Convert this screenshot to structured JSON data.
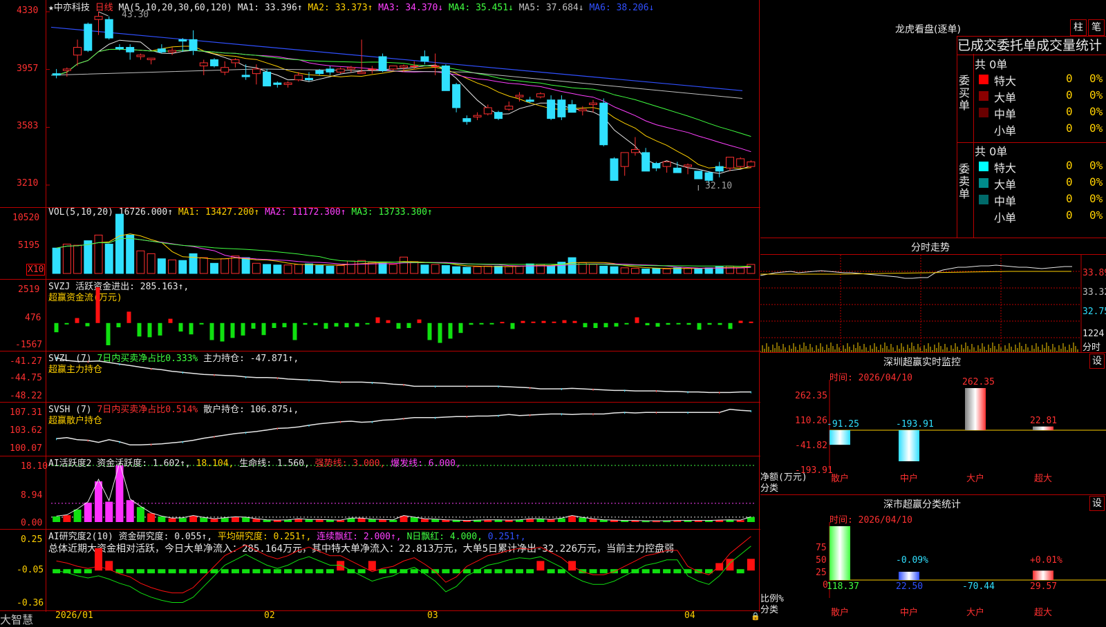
{
  "brand": "大智慧",
  "stock": {
    "name": "中亦科技",
    "period": "日线"
  },
  "main": {
    "ma_label": "MA(5,10,20,30,60,120)",
    "ma_items": [
      {
        "name": "MA1:",
        "value": "33.396↑",
        "color": "#e8e8e8"
      },
      {
        "name": "MA2:",
        "value": "33.373↑",
        "color": "#ffd000"
      },
      {
        "name": "MA3:",
        "value": "34.370↓",
        "color": "#ff40ff"
      },
      {
        "name": "MA4:",
        "value": "35.451↓",
        "color": "#40ff40"
      },
      {
        "name": "MA5:",
        "value": "37.684↓",
        "color": "#c0c0c0"
      },
      {
        "name": "MA6:",
        "value": "38.206↓",
        "color": "#3050ff"
      }
    ],
    "yticks": [
      "4330",
      "3957",
      "3583",
      "3210"
    ],
    "high_label": "43.30",
    "low_label": "32.10"
  },
  "vol": {
    "label": "VOL(5,10,20)",
    "value": "16726.000↑",
    "ma": [
      {
        "t": "MA1: 13427.200↑",
        "c": "#ffd000"
      },
      {
        "t": "MA2: 11172.300↑",
        "c": "#ff40ff"
      },
      {
        "t": "MA3: 13733.300↑",
        "c": "#40ff40"
      }
    ],
    "yticks": [
      "10520",
      "5195"
    ],
    "unit": "X10"
  },
  "svzj": {
    "label": "SVZJ  活跃资金进出: 285.163↑,",
    "sub": "超赢资金流(万元)",
    "yticks": [
      "2519",
      "476",
      "-1567"
    ]
  },
  "svzl": {
    "label1": "SVZL (7)",
    "label2": "7日内买卖净占比0.333%",
    "label3": "主力持仓: -47.871↑,",
    "sub": "超赢主力持仓",
    "yticks": [
      "-41.27",
      "-44.75",
      "-48.22"
    ]
  },
  "svsh": {
    "label1": "SVSH (7)",
    "label2": "7日内买卖净占比0.514%",
    "label3": "散户持仓: 106.875↓,",
    "sub": "超赢散户持仓",
    "yticks": [
      "107.31",
      "103.62",
      "100.07"
    ]
  },
  "ai2": {
    "items": [
      {
        "t": "AI活跃度2 资金活跃度: 1.602↑,",
        "c": "#e8e8e8"
      },
      {
        "t": "18.104,",
        "c": "#ffd000"
      },
      {
        "t": "生命线: 1.560,",
        "c": "#e8e8e8"
      },
      {
        "t": "强势线: 3.000,",
        "c": "#ff3030"
      },
      {
        "t": "爆发线: 6.000,",
        "c": "#ff40ff"
      }
    ],
    "yticks": [
      "18.10",
      "8.94",
      "0.00"
    ]
  },
  "air": {
    "items": [
      {
        "t": "AI研究度2(10) 资金研究度: 0.055↑,",
        "c": "#e8e8e8"
      },
      {
        "t": "平均研究度: 0.251↑,",
        "c": "#ffd000"
      },
      {
        "t": "连续飘红: 2.000↑,",
        "c": "#ff40ff"
      },
      {
        "t": "N日飘红: 4.000,",
        "c": "#40ff40"
      },
      {
        "t": "0.251↑,",
        "c": "#3050ff"
      }
    ],
    "desc": "总体近期大资金相对活跃，今日大单净流入：285.164万元，其中特大单净流入：22.813万元，大单5日累计净出-32.226万元，当前主力控盘弱",
    "yticks": [
      "0.25",
      "-0.05",
      "-0.36"
    ]
  },
  "xaxis": [
    "2026/01",
    "02",
    "03",
    "04"
  ],
  "lhb": {
    "title": "龙虎看盘(逐单)",
    "btn1": "柱",
    "btn2": "笔",
    "header": "已成交委托单成交量统计",
    "buy_label": "委买单",
    "sell_label": "委卖单",
    "total": "共 0单",
    "rows": [
      {
        "name": "特大",
        "v": "0",
        "p": "0%"
      },
      {
        "name": "大单",
        "v": "0",
        "p": "0%"
      },
      {
        "name": "中单",
        "v": "0",
        "p": "0%"
      },
      {
        "name": "小单",
        "v": "0",
        "p": "0%"
      }
    ],
    "buy_colors": [
      "#ff0000",
      "#8b0000",
      "#6a0000",
      "#000000"
    ],
    "sell_colors": [
      "#00ffff",
      "#008b8b",
      "#006a6a",
      "#000000"
    ]
  },
  "fenshi": {
    "title": "分时走势",
    "yticks": [
      "33.89",
      "33.32",
      "32.75",
      "1224"
    ],
    "unit": "分时"
  },
  "sz_rt": {
    "title": "深圳超赢实时监控",
    "btn": "设",
    "time": "时间: 2026/04/10",
    "yticks": [
      "262.35",
      "110.26",
      "-41.82",
      "-193.91"
    ],
    "ylabel": "净额(万元)",
    "xlabel": "分类",
    "cats": [
      "散户",
      "中户",
      "大户",
      "超大"
    ],
    "values": [
      -91.25,
      -193.91,
      262.35,
      22.81
    ],
    "labels": [
      "-91.25",
      "-193.91",
      "262.35",
      "22.81"
    ]
  },
  "sz_cat": {
    "title": "深市超赢分类统计",
    "btn": "设",
    "time": "时间: 2026/04/10",
    "yticks": [
      "75",
      "50",
      "25",
      "0"
    ],
    "ylabel": "比例%",
    "xlabel": "分类",
    "cats": [
      "散户",
      "中户",
      "大户",
      "超大"
    ],
    "values": [
      118.37,
      22.5,
      -70.44,
      29.57
    ],
    "top_labels": [
      "",
      "-0.09%",
      "",
      "+0.01%"
    ],
    "vals_text": [
      "118.37",
      "22.50",
      "-70.44",
      "29.57"
    ]
  },
  "chart_data": [
    {
      "type": "candlestick",
      "title": "中亦科技 日线",
      "yticks": [
        43.3,
        39.57,
        35.83,
        32.1
      ],
      "high": 43.3,
      "low": 32.1,
      "ohlc": [
        [
          39.3,
          39.6,
          39.0,
          39.2
        ],
        [
          39.5,
          39.7,
          39.1,
          39.6
        ],
        [
          40.5,
          41.5,
          39.8,
          41.0
        ],
        [
          42.5,
          42.6,
          40.7,
          40.8
        ],
        [
          42.8,
          43.3,
          41.8,
          43.0
        ],
        [
          42.8,
          43.0,
          41.5,
          41.6
        ],
        [
          41.0,
          41.2,
          40.8,
          40.9
        ],
        [
          41.0,
          41.2,
          40.2,
          40.7
        ],
        [
          40.4,
          40.6,
          40.2,
          40.5
        ],
        [
          40.2,
          40.3,
          39.9,
          40.3
        ],
        [
          40.9,
          41.2,
          40.6,
          40.7
        ],
        [
          40.7,
          41.0,
          40.5,
          40.8
        ],
        [
          41.5,
          41.6,
          40.7,
          41.4
        ],
        [
          41.5,
          42.1,
          40.5,
          40.8
        ],
        [
          39.8,
          40.2,
          39.2,
          40.0
        ],
        [
          40.2,
          40.3,
          39.7,
          39.8
        ],
        [
          39.4,
          40.1,
          39.2,
          39.7
        ],
        [
          40.0,
          40.3,
          39.7,
          40.2
        ],
        [
          39.2,
          39.9,
          38.9,
          39.1
        ],
        [
          39.3,
          39.9,
          38.6,
          39.6
        ],
        [
          39.4,
          39.6,
          38.6,
          38.5
        ],
        [
          38.7,
          38.8,
          38.4,
          38.6
        ],
        [
          38.6,
          38.8,
          38.4,
          38.7
        ],
        [
          38.9,
          39.4,
          38.8,
          39.2
        ],
        [
          39.0,
          39.4,
          38.8,
          38.9
        ],
        [
          39.5,
          39.6,
          39.2,
          39.3
        ],
        [
          39.6,
          39.8,
          39.2,
          39.4
        ],
        [
          39.4,
          39.7,
          39.3,
          39.6
        ],
        [
          39.6,
          39.8,
          39.4,
          39.7
        ],
        [
          39.3,
          41.5,
          39.3,
          39.4
        ],
        [
          39.6,
          39.8,
          39.3,
          39.6
        ],
        [
          40.4,
          40.6,
          39.4,
          39.5
        ],
        [
          39.6,
          39.8,
          39.5,
          39.8
        ],
        [
          39.7,
          39.9,
          39.4,
          39.8
        ],
        [
          39.8,
          40.1,
          39.6,
          39.8
        ],
        [
          40.4,
          40.8,
          39.9,
          40.1
        ],
        [
          39.8,
          40.6,
          39.2,
          39.8
        ],
        [
          39.8,
          39.9,
          38.2,
          38.2
        ],
        [
          38.6,
          38.7,
          36.8,
          37.1
        ],
        [
          36.4,
          36.6,
          36.0,
          36.2
        ],
        [
          36.5,
          36.8,
          36.3,
          36.6
        ],
        [
          36.7,
          37.3,
          36.6,
          37.1
        ],
        [
          36.8,
          36.9,
          36.3,
          36.4
        ],
        [
          37.0,
          37.5,
          36.9,
          37.2
        ],
        [
          37.8,
          38.1,
          37.5,
          37.9
        ],
        [
          37.6,
          37.8,
          37.4,
          37.5
        ],
        [
          37.8,
          38.1,
          37.7,
          38.0
        ],
        [
          37.6,
          37.9,
          36.3,
          36.4
        ],
        [
          37.6,
          37.9,
          36.3,
          36.5
        ],
        [
          37.3,
          37.6,
          36.8,
          36.8
        ],
        [
          36.9,
          37.2,
          36.6,
          37.0
        ],
        [
          37.3,
          37.6,
          36.8,
          37.4
        ],
        [
          37.4,
          37.7,
          34.6,
          34.7
        ],
        [
          33.8,
          33.9,
          32.4,
          32.4
        ],
        [
          33.3,
          34.2,
          32.7,
          34.2
        ],
        [
          34.2,
          35.2,
          34.0,
          34.4
        ],
        [
          34.2,
          34.5,
          33.1,
          33.0
        ],
        [
          33.5,
          33.6,
          33.0,
          33.2
        ],
        [
          33.3,
          33.6,
          32.9,
          33.6
        ],
        [
          33.2,
          33.6,
          32.9,
          32.9
        ],
        [
          33.3,
          33.5,
          32.8,
          33.4
        ],
        [
          33.0,
          33.0,
          32.5,
          32.5
        ],
        [
          32.9,
          33.0,
          32.1,
          32.4
        ],
        [
          33.3,
          33.6,
          32.6,
          33.0
        ],
        [
          33.2,
          33.9,
          33.0,
          33.9
        ],
        [
          33.3,
          33.9,
          33.2,
          33.8
        ],
        [
          33.3,
          33.7,
          33.2,
          33.6
        ]
      ]
    },
    {
      "type": "bar",
      "title": "VOL(5,10,20)",
      "values": [
        4.5,
        5.2,
        5.0,
        5.8,
        6.8,
        5.2,
        10.5,
        6.8,
        4.0,
        3.5,
        2.6,
        2.4,
        2.3,
        3.5,
        2.8,
        1.8,
        2.6,
        3.1,
        2.8,
        1.8,
        1.6,
        1.5,
        1.5,
        1.6,
        1.7,
        1.4,
        1.3,
        1.4,
        2.2,
        2.3,
        2.0,
        1.8,
        1.6,
        2.9,
        2.1,
        1.5,
        1.6,
        1.4,
        1.2,
        1.1,
        1.2,
        1.3,
        1.3,
        1.2,
        1.3,
        1.7,
        1.6,
        1.4,
        2.0,
        2.8,
        1.9,
        1.6,
        1.3,
        1.2,
        1.0,
        0.9,
        0.8,
        0.9,
        0.8,
        1.0,
        0.9,
        0.9,
        1.0,
        1.2,
        1.3,
        1.0,
        1.6
      ]
    },
    {
      "type": "bar",
      "title": "SVZJ",
      "values": [
        -650,
        -100,
        350,
        -230,
        2519,
        -1567,
        -300,
        800,
        -950,
        -1000,
        -880,
        300,
        -600,
        -800,
        -100,
        -1200,
        -1300,
        -1050,
        -880,
        -400,
        -850,
        -350,
        -300,
        -1200,
        -120,
        -150,
        -400,
        -250,
        -300,
        -250,
        -100,
        400,
        200,
        -400,
        -350,
        250,
        -1200,
        -1400,
        -1100,
        -700,
        -120,
        -100,
        -80,
        80,
        -420,
        150,
        100,
        150,
        100,
        200,
        150,
        -300,
        -350,
        -300,
        -250,
        -100,
        400,
        -160,
        -260,
        -120,
        -80,
        -120,
        -470,
        -120,
        -130,
        -420,
        160,
        100
      ]
    },
    {
      "type": "line",
      "title": "SVZL",
      "values": [
        -41.3,
        -41.8,
        -42.0,
        -42.0,
        -41.9,
        -42.2,
        -42.5,
        -42.8,
        -43.1,
        -43.4,
        -43.6,
        -43.9,
        -44.1,
        -44.3,
        -44.5,
        -44.6,
        -44.7,
        -44.8,
        -45.0,
        -45.1,
        -45.1,
        -45.2,
        -45.4,
        -45.5,
        -45.6,
        -45.7,
        -45.9,
        -46.0,
        -46.0,
        -46.0,
        -46.1,
        -46.2,
        -46.4,
        -46.5,
        -46.8,
        -46.8,
        -46.8,
        -46.8,
        -46.8,
        -46.8,
        -46.8,
        -46.8,
        -46.8,
        -46.9,
        -47.0,
        -47.1,
        -47.3,
        -47.3,
        -47.3,
        -47.2,
        -47.3,
        -47.4,
        -47.5,
        -47.6,
        -47.6,
        -47.7,
        -47.7,
        -47.7,
        -47.8,
        -47.8,
        -47.9,
        -47.9,
        -48.0,
        -48.0,
        -48.0,
        -47.9,
        -47.9
      ]
    },
    {
      "type": "line",
      "title": "SVSH",
      "values": [
        101.5,
        101.7,
        101.3,
        101.2,
        100.8,
        101.3,
        100.9,
        100.3,
        100.3,
        100.4,
        100.5,
        100.7,
        100.9,
        101.2,
        101.6,
        101.9,
        102.2,
        102.5,
        102.7,
        102.9,
        103.2,
        103.5,
        103.6,
        103.8,
        104.1,
        104.4,
        104.6,
        104.8,
        104.9,
        104.7,
        104.8,
        105.1,
        105.2,
        105.4,
        105.6,
        105.6,
        105.6,
        105.7,
        105.8,
        105.8,
        105.9,
        105.9,
        106.0,
        106.2,
        106.0,
        106.1,
        106.2,
        106.3,
        106.3,
        106.2,
        106.3,
        106.3,
        106.3,
        106.5,
        106.6,
        106.5,
        106.6,
        106.6,
        106.6,
        106.6,
        106.6,
        106.6,
        106.6,
        106.6,
        107.2,
        107.0,
        106.9
      ]
    },
    {
      "type": "bar",
      "title": "AI活跃度2",
      "values": [
        1.8,
        2.2,
        4.0,
        6.2,
        13.0,
        6.5,
        18.1,
        7.0,
        4.8,
        2.8,
        1.8,
        1.2,
        1.3,
        2.0,
        1.4,
        1.0,
        1.3,
        1.6,
        1.5,
        1.0,
        0.7,
        0.6,
        0.7,
        1.0,
        0.8,
        0.8,
        0.7,
        0.6,
        1.2,
        1.2,
        0.9,
        0.8,
        0.7,
        2.0,
        1.5,
        1.0,
        0.9,
        0.7,
        0.6,
        0.5,
        0.6,
        0.7,
        0.7,
        0.6,
        0.7,
        1.0,
        1.0,
        0.8,
        1.2,
        2.0,
        1.4,
        1.0,
        0.7,
        0.6,
        0.5,
        0.5,
        0.4,
        0.4,
        0.4,
        0.5,
        0.5,
        0.5,
        0.5,
        0.6,
        0.7,
        0.6,
        1.6
      ]
    },
    {
      "type": "bar",
      "title": "AI研究度2(10)",
      "values": [
        0.0,
        -0.02,
        -0.05,
        0.0,
        0.16,
        0.04,
        0.0,
        -0.02,
        -0.05,
        -0.04,
        -0.06,
        -0.05,
        -0.05,
        0.0,
        -0.05,
        -0.06,
        -0.05,
        -0.06,
        -0.05,
        -0.05,
        -0.06,
        -0.05,
        -0.04,
        -0.05,
        -0.04,
        -0.03,
        0.0,
        0.04,
        0.0,
        -0.02,
        0.04,
        -0.02,
        -0.02,
        -0.05,
        -0.05,
        0.0,
        -0.04,
        -0.02,
        -0.01,
        -0.05,
        -0.06,
        -0.05,
        -0.04,
        -0.06,
        -0.04,
        0.0,
        0.04,
        -0.02,
        -0.03,
        0.04,
        0.0,
        -0.03,
        -0.06,
        -0.07,
        -0.05,
        -0.05,
        -0.04,
        -0.05,
        -0.04,
        -0.04,
        -0.04,
        -0.01,
        -0.02,
        0.02,
        0.06,
        -0.02,
        0.06
      ]
    },
    {
      "type": "bar",
      "title": "深圳超赢实时监控",
      "categories": [
        "散户",
        "中户",
        "大户",
        "超大"
      ],
      "values": [
        -91.25,
        -193.91,
        262.35,
        22.81
      ]
    },
    {
      "type": "bar",
      "title": "深市超赢分类统计",
      "categories": [
        "散户",
        "中户",
        "大户",
        "超大"
      ],
      "values": [
        118.37,
        22.5,
        -70.44,
        29.57
      ]
    }
  ]
}
